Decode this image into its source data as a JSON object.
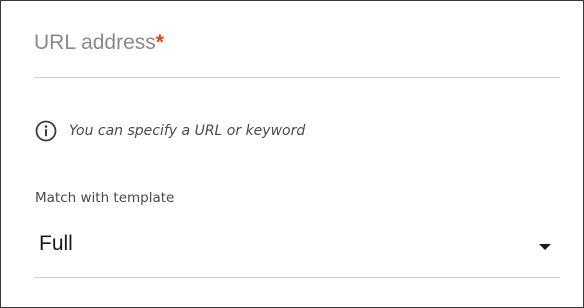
{
  "url_field": {
    "placeholder": "URL address",
    "required_marker": "*",
    "value": ""
  },
  "hint": {
    "icon": "info-icon",
    "text": "You can specify a URL or keyword"
  },
  "match_template": {
    "label": "Match with template",
    "selected_value": "Full"
  },
  "colors": {
    "required": "#e2421f",
    "placeholder": "#8a8a8a",
    "underline": "#cfcfcf",
    "border": "#3a3a3a"
  }
}
